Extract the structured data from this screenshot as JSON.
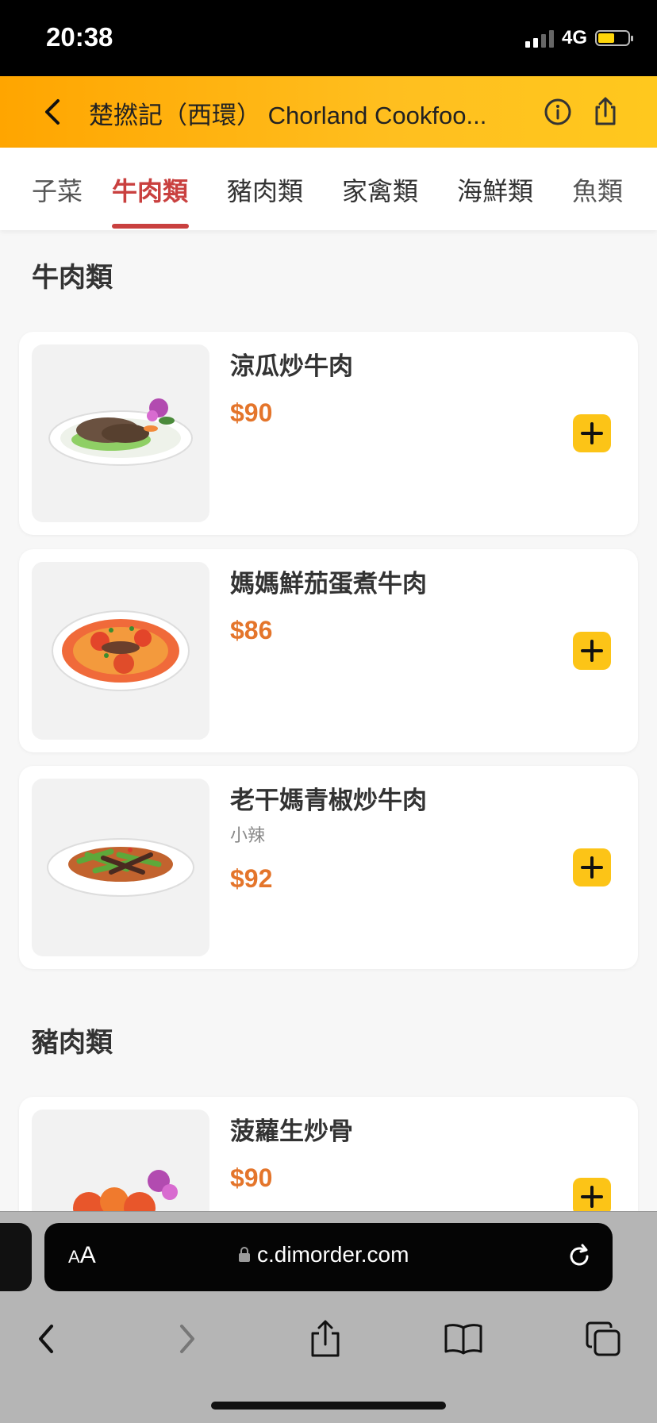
{
  "status_bar": {
    "time": "20:38",
    "network": "4G"
  },
  "header": {
    "title": "楚撚記（西環） Chorland Cookfoo..."
  },
  "tabs": [
    {
      "label": "子菜",
      "active": false
    },
    {
      "label": "牛肉類",
      "active": true
    },
    {
      "label": "豬肉類",
      "active": false
    },
    {
      "label": "家禽類",
      "active": false
    },
    {
      "label": "海鮮類",
      "active": false
    },
    {
      "label": "魚類",
      "active": false
    }
  ],
  "sections": [
    {
      "title": "牛肉類",
      "items": [
        {
          "name": "涼瓜炒牛肉",
          "note": "",
          "price": "$90"
        },
        {
          "name": "媽媽鮮茄蛋煮牛肉",
          "note": "",
          "price": "$86"
        },
        {
          "name": "老干媽青椒炒牛肉",
          "note": "小辣",
          "price": "$92"
        }
      ]
    },
    {
      "title": "豬肉類",
      "items": [
        {
          "name": "菠蘿生炒骨",
          "note": "",
          "price": "$90"
        }
      ]
    }
  ],
  "browser": {
    "aa_label": "AA",
    "url": "c.dimorder.com"
  },
  "colors": {
    "accent": "#c9403f",
    "price": "#e4752b",
    "header": "#ffb40f",
    "add_button": "#fcc417"
  }
}
